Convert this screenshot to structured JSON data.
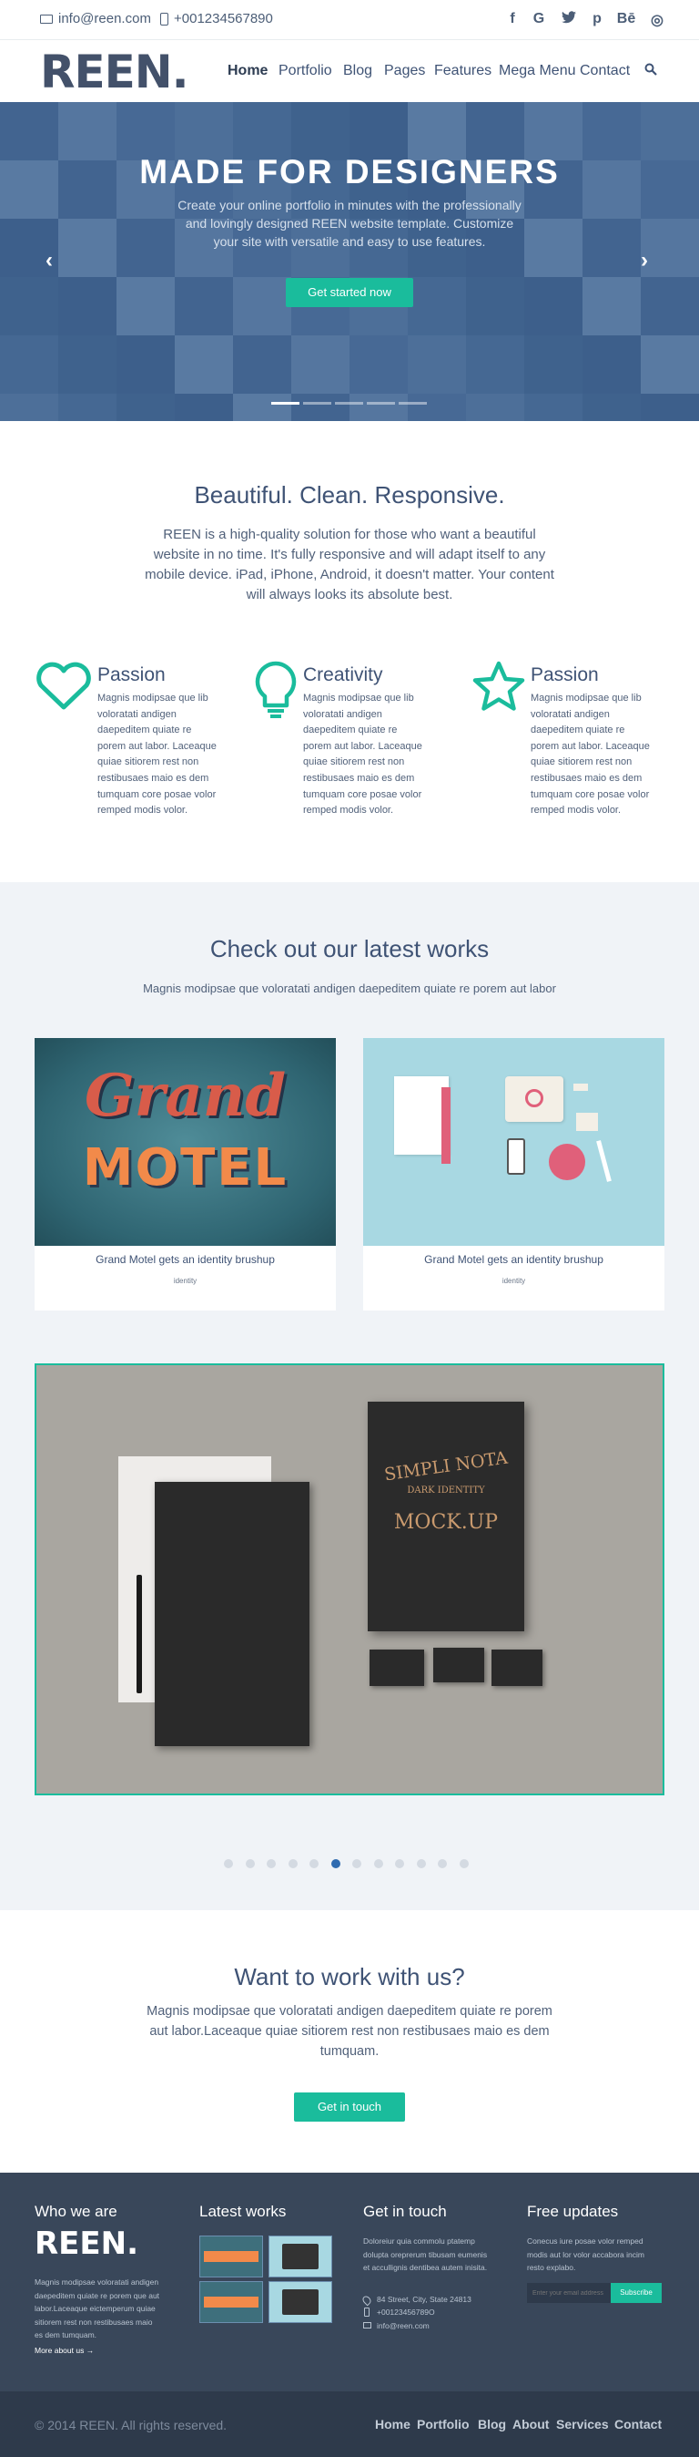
{
  "topbar": {
    "email": "info@reen.com",
    "phone": "+001234567890",
    "social": [
      "f",
      "G",
      "t",
      "p",
      "Bē",
      "◎"
    ]
  },
  "nav": {
    "logo": "REEN.",
    "links": [
      "Home",
      "Portfolio",
      "Blog",
      "Pages",
      "Features",
      "Mega Menu",
      "Contact"
    ],
    "active": "Home"
  },
  "hero": {
    "title": "MADE FOR DESIGNERS",
    "subtitle": "Create your online portfolio in minutes with the professionally and lovingly designed REEN website template. Customize your site with versatile and easy to use features.",
    "button": "Get started now",
    "slides": 5,
    "active_slide": 1
  },
  "intro": {
    "title": "Beautiful. Clean. Responsive.",
    "text": "REEN is a high-quality solution for those who want a beautiful website in no time. It's fully responsive and will adapt itself to any mobile device. iPad, iPhone, Android, it doesn't matter. Your content will always looks its absolute best."
  },
  "features": [
    {
      "title": "Passion",
      "icon": "heart-icon",
      "text": "Magnis modipsae que lib voloratati andigen daepeditem quiate re porem aut labor. Laceaque quiae sitiorem rest non restibusaes maio es dem tumquam core posae volor remped modis volor."
    },
    {
      "title": "Creativity",
      "icon": "lightbulb-icon",
      "text": "Magnis modipsae que lib voloratati andigen daepeditem quiate re porem aut labor. Laceaque quiae sitiorem rest non restibusaes maio es dem tumquam core posae volor remped modis volor."
    },
    {
      "title": "Passion",
      "icon": "star-icon",
      "text": "Magnis modipsae que lib voloratati andigen daepeditem quiate re porem aut labor. Laceaque quiae sitiorem rest non restibusaes maio es dem tumquam core posae volor remped modis volor."
    }
  ],
  "works": {
    "title": "Check out our latest works",
    "subtitle": "Magnis modipsae que voloratati andigen daepeditem quiate re porem aut labor",
    "cards": [
      {
        "title": "Grand Motel gets an identity brushup",
        "tag": "identity",
        "image_text_1": "Grand",
        "image_text_2": "MOTEL"
      },
      {
        "title": "Grand Motel gets an identity brushup",
        "tag": "identity"
      }
    ],
    "mockup_text_1": "SIMPLI NOTA",
    "mockup_text_2": "DARK IDENTITY",
    "mockup_text_3": "MOCK.UP",
    "dots": 12,
    "active_dot": 5
  },
  "cta": {
    "title": "Want to work with us?",
    "text": "Magnis modipsae que voloratati andigen daepeditem quiate re porem aut labor.Laceaque quiae sitiorem rest non restibusaes maio es dem tumquam.",
    "button": "Get in touch"
  },
  "footer": {
    "col1": {
      "title": "Who we are",
      "logo": "REEN.",
      "text": "Magnis modipsae voloratati andigen daepeditem quiate re porem que aut labor.Laceaque eictemperum quiae sitiorem rest non restibusaes maio es dem tumquam.",
      "link": "More about us →"
    },
    "col2": {
      "title": "Latest works"
    },
    "col3": {
      "title": "Get in touch",
      "text": "Doloreiur quia commolu ptatemp dolupta oreprerum tibusam eumenis et accullignis dentibea autem inisita.",
      "address": "84 Street, City, State 24813",
      "phone": "+00123456789O",
      "email": "info@reen.com"
    },
    "col4": {
      "title": "Free updates",
      "text": "Conecus iure posae volor remped modis aut lor volor accabora incim resto explabo.",
      "placeholder": "Enter your email address",
      "button": "Subscribe"
    }
  },
  "bottom": {
    "copyright": "© 2014 REEN. All rights reserved.",
    "links": [
      "Home",
      "Portfolio",
      "Blog",
      "About",
      "Services",
      "Contact"
    ]
  },
  "colors": {
    "accent": "#1abc9c",
    "dark": "#39475a",
    "text": "#3f5375"
  }
}
